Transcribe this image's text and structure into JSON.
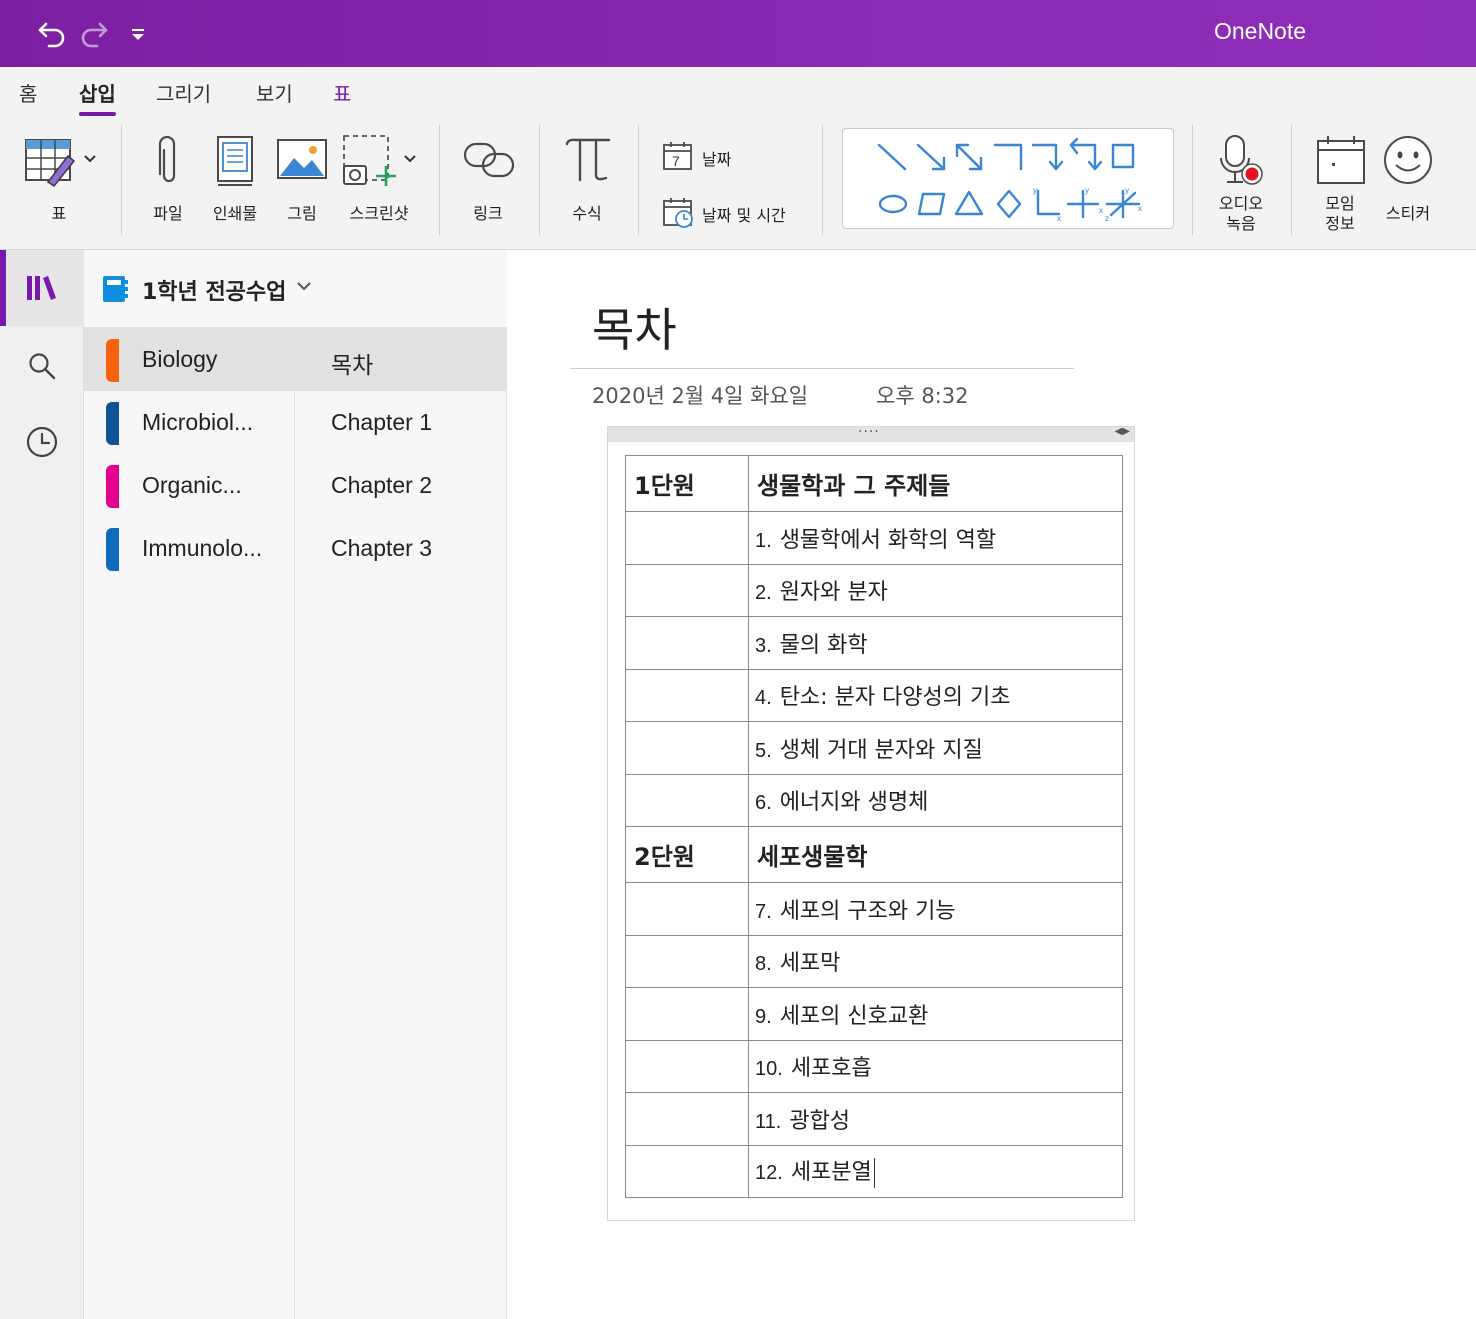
{
  "app": {
    "title": "OneNote"
  },
  "ribbon": {
    "tabs": [
      {
        "label": "홈"
      },
      {
        "label": "삽입"
      },
      {
        "label": "그리기"
      },
      {
        "label": "보기"
      },
      {
        "label": "표"
      }
    ],
    "buttons": {
      "table": "표",
      "file": "파일",
      "printout": "인쇄물",
      "picture": "그림",
      "screenshot": "스크린샷",
      "link": "링크",
      "equation": "수식",
      "date": "날짜",
      "datetime": "날짜 및 시간",
      "audio_line1": "오디오",
      "audio_line2": "녹음",
      "meeting_line1": "모임",
      "meeting_line2": "정보",
      "sticker": "스티커"
    },
    "date_icon_day": "7"
  },
  "notebook": {
    "title": "1학년 전공수업"
  },
  "sections": [
    {
      "label": "Biology",
      "color": "#f7630c"
    },
    {
      "label": "Microbiol...",
      "color": "#0f5296"
    },
    {
      "label": "Organic...",
      "color": "#e3008c"
    },
    {
      "label": "Immunolo...",
      "color": "#0f6cbd"
    }
  ],
  "pages": [
    {
      "label": "목차"
    },
    {
      "label": "Chapter 1"
    },
    {
      "label": "Chapter 2"
    },
    {
      "label": "Chapter 3"
    }
  ],
  "page": {
    "title": "목차",
    "date": "2020년 2월 4일 화요일",
    "time": "오후 8:32",
    "table": [
      {
        "unit": "1단원",
        "text": "생물학과 그 주제들"
      },
      {
        "num": "1.",
        "text": "생물학에서 화학의 역할"
      },
      {
        "num": "2.",
        "text": "원자와 분자"
      },
      {
        "num": "3.",
        "text": "물의 화학"
      },
      {
        "num": "4.",
        "text": "탄소: 분자 다양성의 기초"
      },
      {
        "num": "5.",
        "text": "생체 거대 분자와 지질"
      },
      {
        "num": "6.",
        "text": "에너지와 생명체"
      },
      {
        "unit": "2단원",
        "text": "세포생물학"
      },
      {
        "num": "7.",
        "text": "세포의 구조와 기능"
      },
      {
        "num": "8.",
        "text": "세포막"
      },
      {
        "num": "9.",
        "text": "세포의 신호교환"
      },
      {
        "num": "10.",
        "text": "세포호흡"
      },
      {
        "num": "11.",
        "text": "광합성"
      },
      {
        "num": "12.",
        "text": "세포분열"
      }
    ]
  },
  "colors": {
    "accent": "#7719aa",
    "shape_blue": "#3a86d4"
  }
}
